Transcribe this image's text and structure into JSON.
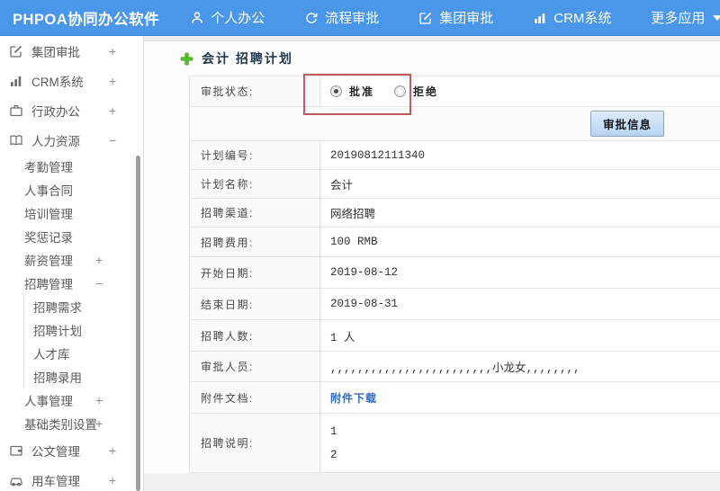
{
  "header": {
    "logo": "PHPOA协同办公软件",
    "nav": [
      {
        "label": "个人办公",
        "icon": "user-icon"
      },
      {
        "label": "流程审批",
        "icon": "process-icon"
      },
      {
        "label": "集团审批",
        "icon": "edit-icon"
      },
      {
        "label": "CRM系统",
        "icon": "bar-chart-icon"
      },
      {
        "label": "更多应用",
        "icon": "caret-down-icon"
      }
    ]
  },
  "sidebar": {
    "items": [
      {
        "label": "集团审批",
        "icon": "edit-icon",
        "toggle": "+"
      },
      {
        "label": "CRM系统",
        "icon": "bar-chart-icon",
        "toggle": "+"
      },
      {
        "label": "行政办公",
        "icon": "briefcase-icon",
        "toggle": "+"
      },
      {
        "label": "人力资源",
        "icon": "book-icon",
        "toggle": "−"
      },
      {
        "label": "考勤管理",
        "toggle": ""
      },
      {
        "label": "人事合同",
        "toggle": ""
      },
      {
        "label": "培训管理",
        "toggle": ""
      },
      {
        "label": "奖惩记录",
        "toggle": ""
      },
      {
        "label": "薪资管理",
        "toggle": "+"
      },
      {
        "label": "招聘管理",
        "toggle": "−"
      },
      {
        "label": "招聘需求",
        "toggle": ""
      },
      {
        "label": "招聘计划",
        "toggle": ""
      },
      {
        "label": "人才库",
        "toggle": ""
      },
      {
        "label": "招聘录用",
        "toggle": ""
      },
      {
        "label": "人事管理",
        "toggle": "+"
      },
      {
        "label": "基础类别设置",
        "toggle": "+"
      },
      {
        "label": "公文管理",
        "icon": "document-icon",
        "toggle": "+"
      },
      {
        "label": "用车管理",
        "icon": "car-icon",
        "toggle": "+"
      }
    ]
  },
  "main": {
    "title": "会计 招聘计划",
    "approval": {
      "label": "审批状态:",
      "options": [
        {
          "label": "批准",
          "selected": true
        },
        {
          "label": "拒绝",
          "selected": false
        }
      ],
      "button_label": "审批信息"
    },
    "fields": [
      {
        "label": "计划编号:",
        "value": "20190812111340"
      },
      {
        "label": "计划名称:",
        "value": "会计"
      },
      {
        "label": "招聘渠道:",
        "value": "网络招聘"
      },
      {
        "label": "招聘费用:",
        "value": "100 RMB"
      },
      {
        "label": "开始日期:",
        "value": "2019-08-12"
      },
      {
        "label": "结束日期:",
        "value": "2019-08-31"
      },
      {
        "label": "招聘人数:",
        "value": "1 人"
      },
      {
        "label": "审批人员:",
        "value": ",,,,,,,,,,,,,,,,,,,,,,,,小龙女,,,,,,,,"
      },
      {
        "label": "附件文档:",
        "value": "附件下载",
        "type": "link"
      },
      {
        "label": "招聘说明:",
        "lines": [
          "1",
          "2"
        ]
      }
    ]
  },
  "colors": {
    "header_blue": "#4a97ea",
    "annotation_red": "#c05a60",
    "link_blue": "#2f6bbf",
    "plus_green": "#4fc122",
    "button_blue": "#b6d4f0"
  }
}
